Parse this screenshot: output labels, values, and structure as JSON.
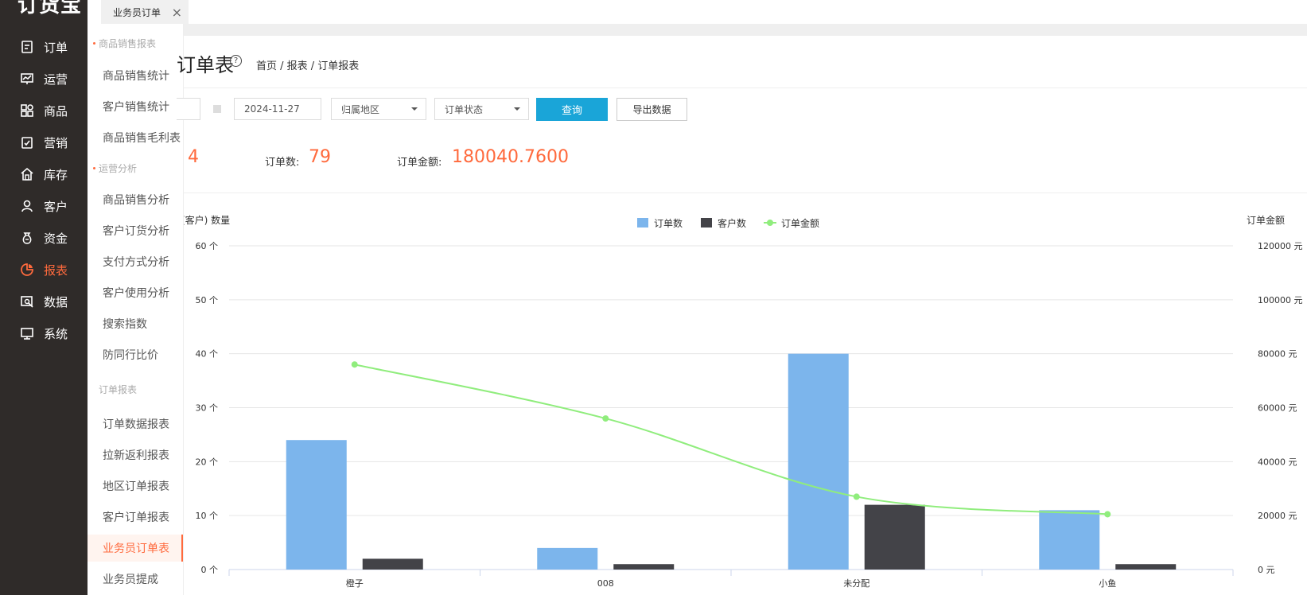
{
  "app": {
    "logo": "订货宝"
  },
  "nav": {
    "items": [
      {
        "label": "订单",
        "icon": "order-icon"
      },
      {
        "label": "运营",
        "icon": "operations-icon"
      },
      {
        "label": "商品",
        "icon": "products-icon"
      },
      {
        "label": "营销",
        "icon": "marketing-icon"
      },
      {
        "label": "库存",
        "icon": "warehouse-icon"
      },
      {
        "label": "客户",
        "icon": "customer-icon"
      },
      {
        "label": "资金",
        "icon": "money-bag-icon"
      },
      {
        "label": "报表",
        "icon": "pie-chart-icon",
        "active": true
      },
      {
        "label": "数据",
        "icon": "data-icon"
      },
      {
        "label": "系统",
        "icon": "monitor-icon"
      }
    ]
  },
  "submenu": {
    "group_sales": "商品销售报表",
    "sales_items": [
      "商品销售统计",
      "客户销售统计",
      "商品销售毛利表"
    ],
    "group_ops": "运营分析",
    "ops_items": [
      "商品销售分析",
      "客户订货分析",
      "支付方式分析",
      "客户使用分析",
      "搜索指数",
      "防同行比价"
    ],
    "group_orders": "订单报表",
    "order_items": [
      "订单数据报表",
      "拉新返利报表",
      "地区订单报表",
      "客户订单报表",
      "业务员订单表",
      "业务员提成"
    ],
    "active": "业务员订单表"
  },
  "tabs": {
    "active_label": "业务员订单",
    "close": "×"
  },
  "header": {
    "title": "订单表",
    "help": "?",
    "breadcrumb": "首页 / 报表 / 订单报表"
  },
  "filters": {
    "end_date": "2024-11-27",
    "region_placeholder": "归属地区",
    "status_placeholder": "订单状态",
    "query_label": "查询",
    "export_label": "导出数据"
  },
  "stats": {
    "first_value": "4",
    "order_count_label": "订单数:",
    "order_count": "79",
    "order_amount_label": "订单金额:",
    "order_amount": "180040.7600"
  },
  "colors": {
    "accent": "#ff6a3d",
    "query_button": "#1aa5d8",
    "orders_bar": "#7cb5ec",
    "customers_bar": "#434348",
    "amount_line": "#90ed7d"
  },
  "chart_data": {
    "type": "bar",
    "categories": [
      "橙子",
      "008",
      "未分配",
      "小鱼"
    ],
    "series": [
      {
        "name": "订单数",
        "type": "bar",
        "axis": "left",
        "values": [
          24,
          4,
          40,
          11
        ]
      },
      {
        "name": "客户数",
        "type": "bar",
        "axis": "left",
        "values": [
          2,
          1,
          12,
          1
        ]
      },
      {
        "name": "订单金额",
        "type": "line",
        "axis": "right",
        "values": [
          76000,
          56000,
          27000,
          20500
        ]
      }
    ],
    "ylabel_left": "(客户) 数量",
    "ylabel_right": "订单金额",
    "ylim_left": [
      0,
      60
    ],
    "ylim_right": [
      0,
      120000
    ],
    "yticks_left": [
      "0 个",
      "10 个",
      "20 个",
      "30 个",
      "40 个",
      "50 个",
      "60 个"
    ],
    "yticks_right": [
      "0 元",
      "20000 元",
      "40000 元",
      "60000 元",
      "80000 元",
      "100000 元",
      "120000 元"
    ],
    "legend_position": "top-center",
    "grid": true
  }
}
